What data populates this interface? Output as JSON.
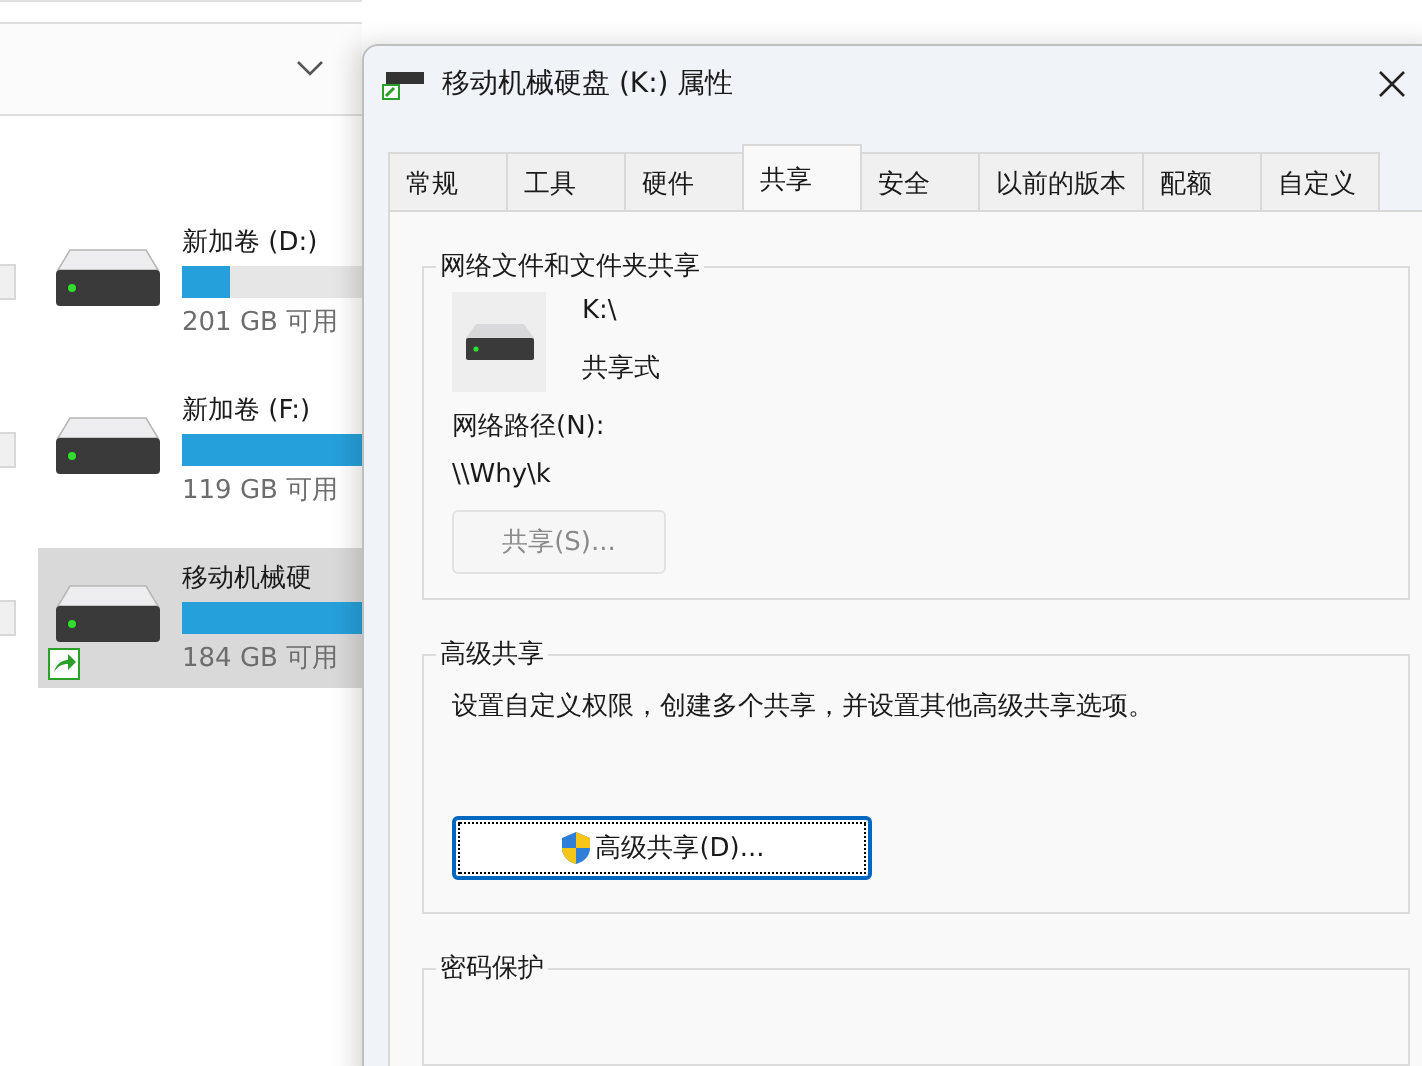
{
  "explorer": {
    "drives": [
      {
        "name": "新加卷 (D:)",
        "level": 0.2,
        "free": "201 GB 可用",
        "shared": false,
        "selected": false
      },
      {
        "name": "新加卷 (F:)",
        "level": 0.75,
        "free": "119 GB 可用",
        "shared": false,
        "selected": false
      },
      {
        "name": "移动机械硬",
        "level": 0.75,
        "free": "184 GB 可用",
        "shared": true,
        "selected": true
      }
    ]
  },
  "dialog": {
    "title": "移动机械硬盘 (K:) 属性",
    "tabs": [
      {
        "label": "常规",
        "selected": false
      },
      {
        "label": "工具",
        "selected": false
      },
      {
        "label": "硬件",
        "selected": false
      },
      {
        "label": "共享",
        "selected": true
      },
      {
        "label": "安全",
        "selected": false
      },
      {
        "label": "以前的版本",
        "selected": false
      },
      {
        "label": "配额",
        "selected": false
      },
      {
        "label": "自定义",
        "selected": false
      }
    ],
    "network_sharing": {
      "legend": "网络文件和文件夹共享",
      "drive": "K:\\",
      "status": "共享式",
      "path_label": "网络路径(N):",
      "path": "\\\\Why\\k",
      "share_button": {
        "label": "共享(S)...",
        "disabled": true
      }
    },
    "advanced_sharing": {
      "legend": "高级共享",
      "description": "设置自定义权限，创建多个共享，并设置其他高级共享选项。",
      "button": {
        "label": "高级共享(D)...",
        "disabled": false
      }
    },
    "password_protection": {
      "legend": "密码保护"
    }
  }
}
